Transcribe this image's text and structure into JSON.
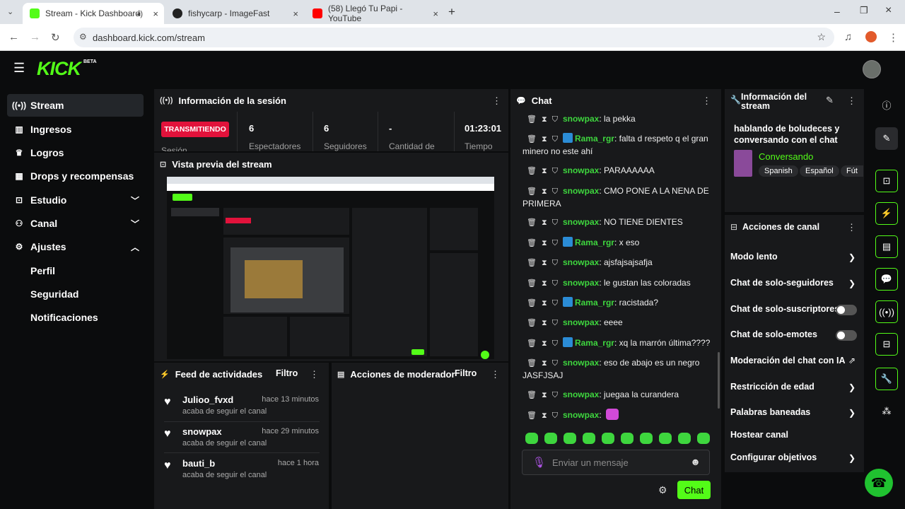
{
  "browser": {
    "tabs": [
      {
        "title": "Stream - Kick Dashboard",
        "favcolor": "#53fc18"
      },
      {
        "title": "fishycarp - ImageFast",
        "favcolor": "#333333"
      },
      {
        "title": "(58) Llegó Tu Papi - YouTube",
        "favcolor": "#ff0000"
      }
    ],
    "url": "dashboard.kick.com/stream"
  },
  "brand": {
    "logo": "KICK",
    "beta": "BETA",
    "accent": "#53fc18"
  },
  "sidebar": {
    "items": [
      {
        "label": "Stream",
        "icon": "stream-icon"
      },
      {
        "label": "Ingresos",
        "icon": "chart-icon"
      },
      {
        "label": "Logros",
        "icon": "trophy-icon"
      },
      {
        "label": "Drops y recompensas",
        "icon": "gift-icon"
      },
      {
        "label": "Estudio",
        "icon": "studio-icon"
      },
      {
        "label": "Canal",
        "icon": "users-icon"
      },
      {
        "label": "Ajustes",
        "icon": "gear-icon"
      }
    ],
    "subitems": [
      "Perfil",
      "Seguridad",
      "Notificaciones"
    ]
  },
  "session": {
    "title": "Información de la sesión",
    "status": "TRANSMITIENDO",
    "status_label": "Sesión",
    "stats": [
      {
        "value": "6",
        "label": "Espectadores"
      },
      {
        "value": "6",
        "label": "Seguidores"
      },
      {
        "value": "-",
        "label": "Cantidad de"
      },
      {
        "value": "01:23:01",
        "label": "Tiempo"
      }
    ]
  },
  "preview": {
    "title": "Vista previa del stream"
  },
  "feed": {
    "title": "Feed de actividades",
    "filter": "Filtro",
    "items": [
      {
        "name": "Julioo_fvxd",
        "time": "hace 13 minutos",
        "sub": "acaba de seguir el canal"
      },
      {
        "name": "snowpax",
        "time": "hace 29 minutos",
        "sub": "acaba de seguir el canal"
      },
      {
        "name": "bauti_b",
        "time": "hace 1 hora",
        "sub": "acaba de seguir el canal"
      }
    ]
  },
  "mod_actions": {
    "title": "Acciones de moderador",
    "filter": "Filtro"
  },
  "chat": {
    "title": "Chat",
    "messages": [
      {
        "user": "snowpax",
        "text": ": la pekka",
        "color": "#3ed63e",
        "badge": false
      },
      {
        "user": "Rama_rgr",
        "text": ": falta d respeto q el gran minero no este ahí",
        "color": "#3ed63e",
        "badge": true
      },
      {
        "user": "snowpax",
        "text": ": PARAAAAAA",
        "color": "#3ed63e",
        "badge": false
      },
      {
        "user": "snowpax",
        "text": ": CMO PONE A LA NENA DE PRIMERA",
        "color": "#3ed63e",
        "badge": false
      },
      {
        "user": "snowpax",
        "text": ": NO TIENE DIENTES",
        "color": "#3ed63e",
        "badge": false
      },
      {
        "user": "Rama_rgr",
        "text": ": x eso",
        "color": "#3ed63e",
        "badge": true
      },
      {
        "user": "snowpax",
        "text": ": ajsfajsajsafja",
        "color": "#3ed63e",
        "badge": false
      },
      {
        "user": "snowpax",
        "text": ": le gustan las coloradas",
        "color": "#3ed63e",
        "badge": false
      },
      {
        "user": "Rama_rgr",
        "text": ": racistada?",
        "color": "#3ed63e",
        "badge": true
      },
      {
        "user": "snowpax",
        "text": ": eeee",
        "color": "#3ed63e",
        "badge": false
      },
      {
        "user": "Rama_rgr",
        "text": ": xq la marrón última????",
        "color": "#3ed63e",
        "badge": true
      },
      {
        "user": "snowpax",
        "text": ": eso de abajo es un negro JASFJSAJ",
        "color": "#3ed63e",
        "badge": false
      },
      {
        "user": "snowpax",
        "text": ": juegaa la curandera",
        "color": "#3ed63e",
        "badge": false
      },
      {
        "user": "snowpax",
        "text": ":",
        "color": "#3ed63e",
        "badge": false
      }
    ],
    "placeholder": "Enviar un mensaje",
    "send": "Chat"
  },
  "stream_info": {
    "title": "Información del stream",
    "stream_title": "hablando de boludeces y conversando con el chat",
    "category": "Conversando",
    "tags": [
      "Spanish",
      "Español",
      "Fút"
    ]
  },
  "channel_actions": {
    "title": "Acciones de canal",
    "items": [
      {
        "label": "Modo lento",
        "kind": "chevron"
      },
      {
        "label": "Chat de solo-seguidores",
        "kind": "chevron"
      },
      {
        "label": "Chat de solo-suscriptores",
        "kind": "toggle"
      },
      {
        "label": "Chat de solo-emotes",
        "kind": "toggle"
      },
      {
        "label": "Moderación del chat con IA",
        "kind": "external"
      },
      {
        "label": "Restricción de edad",
        "kind": "chevron"
      },
      {
        "label": "Palabras baneadas",
        "kind": "chevron"
      },
      {
        "label": "Hostear canal",
        "kind": "none"
      },
      {
        "label": "Configurar objetivos",
        "kind": "chevron"
      }
    ]
  }
}
